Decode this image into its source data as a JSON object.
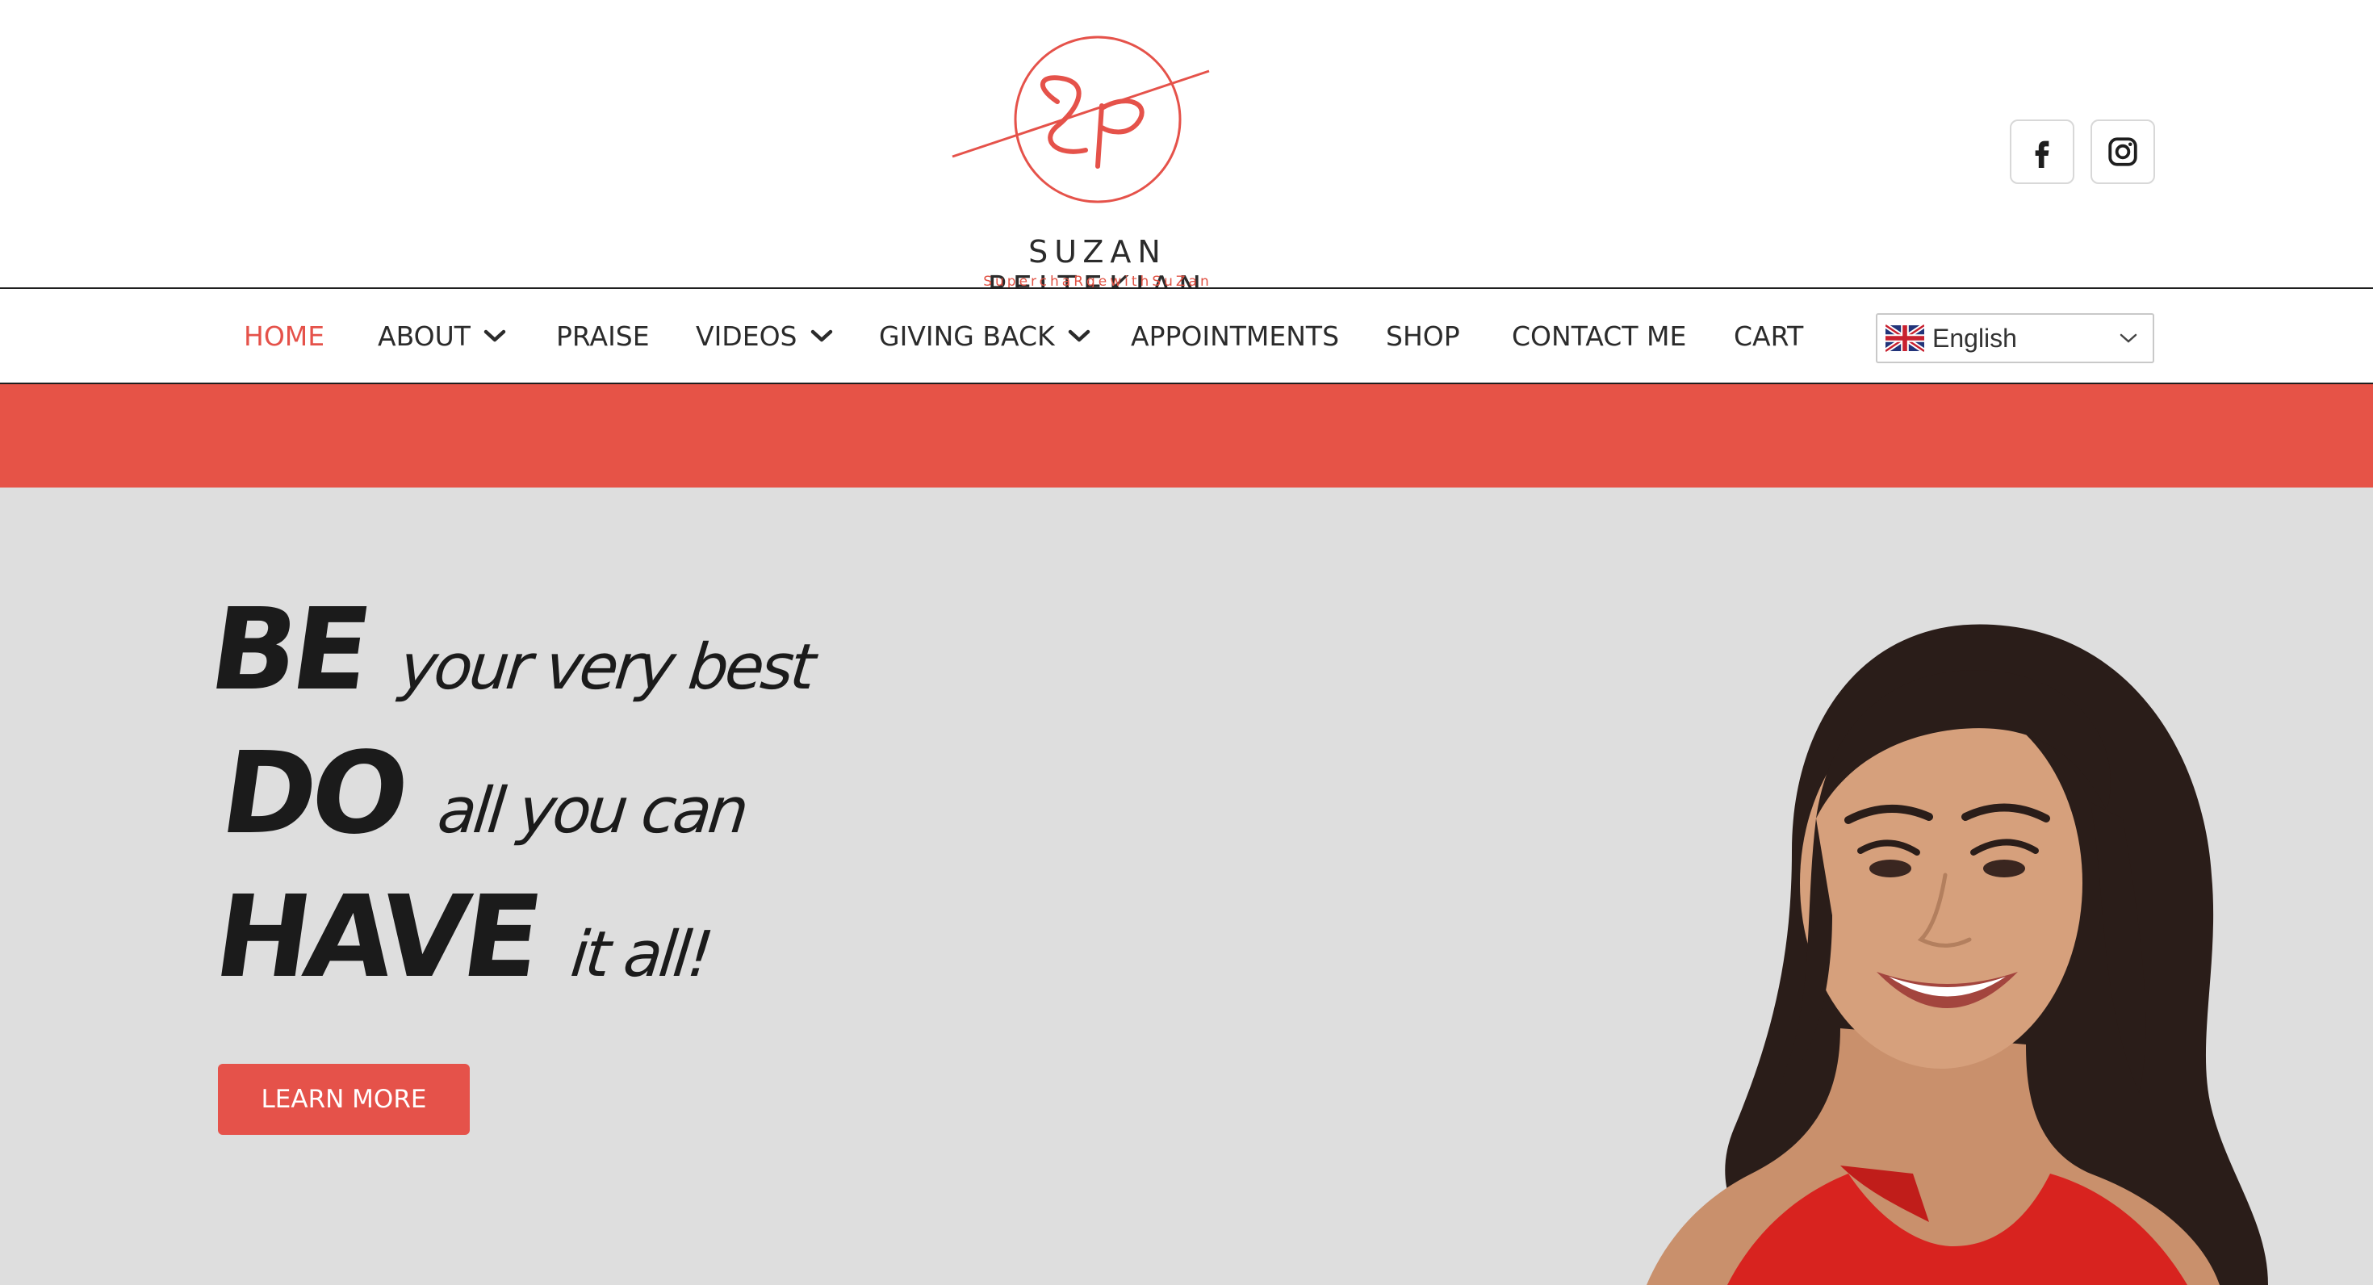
{
  "brand": {
    "name": "SUZAN PELTEKIAN",
    "tagline": "SuperchaRgewithSuZan",
    "monogram": "SP",
    "accent_color": "#e5524a"
  },
  "social": [
    {
      "name": "facebook",
      "icon": "facebook-icon"
    },
    {
      "name": "instagram",
      "icon": "instagram-icon"
    }
  ],
  "nav": {
    "items": [
      {
        "label": "HOME",
        "active": true
      },
      {
        "label": "ABOUT",
        "dropdown": true
      },
      {
        "label": "PRAISE"
      },
      {
        "label": "VIDEOS",
        "dropdown": true
      },
      {
        "label": "GIVING BACK",
        "dropdown": true
      },
      {
        "label": "APPOINTMENTS"
      },
      {
        "label": "SHOP"
      },
      {
        "label": "CONTACT ME"
      },
      {
        "label": "CART"
      }
    ],
    "language": {
      "selected": "English",
      "flag": "uk-flag-icon"
    }
  },
  "hero": {
    "lines": [
      {
        "big": "BE",
        "small": "your very best"
      },
      {
        "big": "DO",
        "small": "all you can"
      },
      {
        "big": "HAVE",
        "small": "it all!"
      }
    ],
    "cta_label": "LEARN MORE"
  }
}
